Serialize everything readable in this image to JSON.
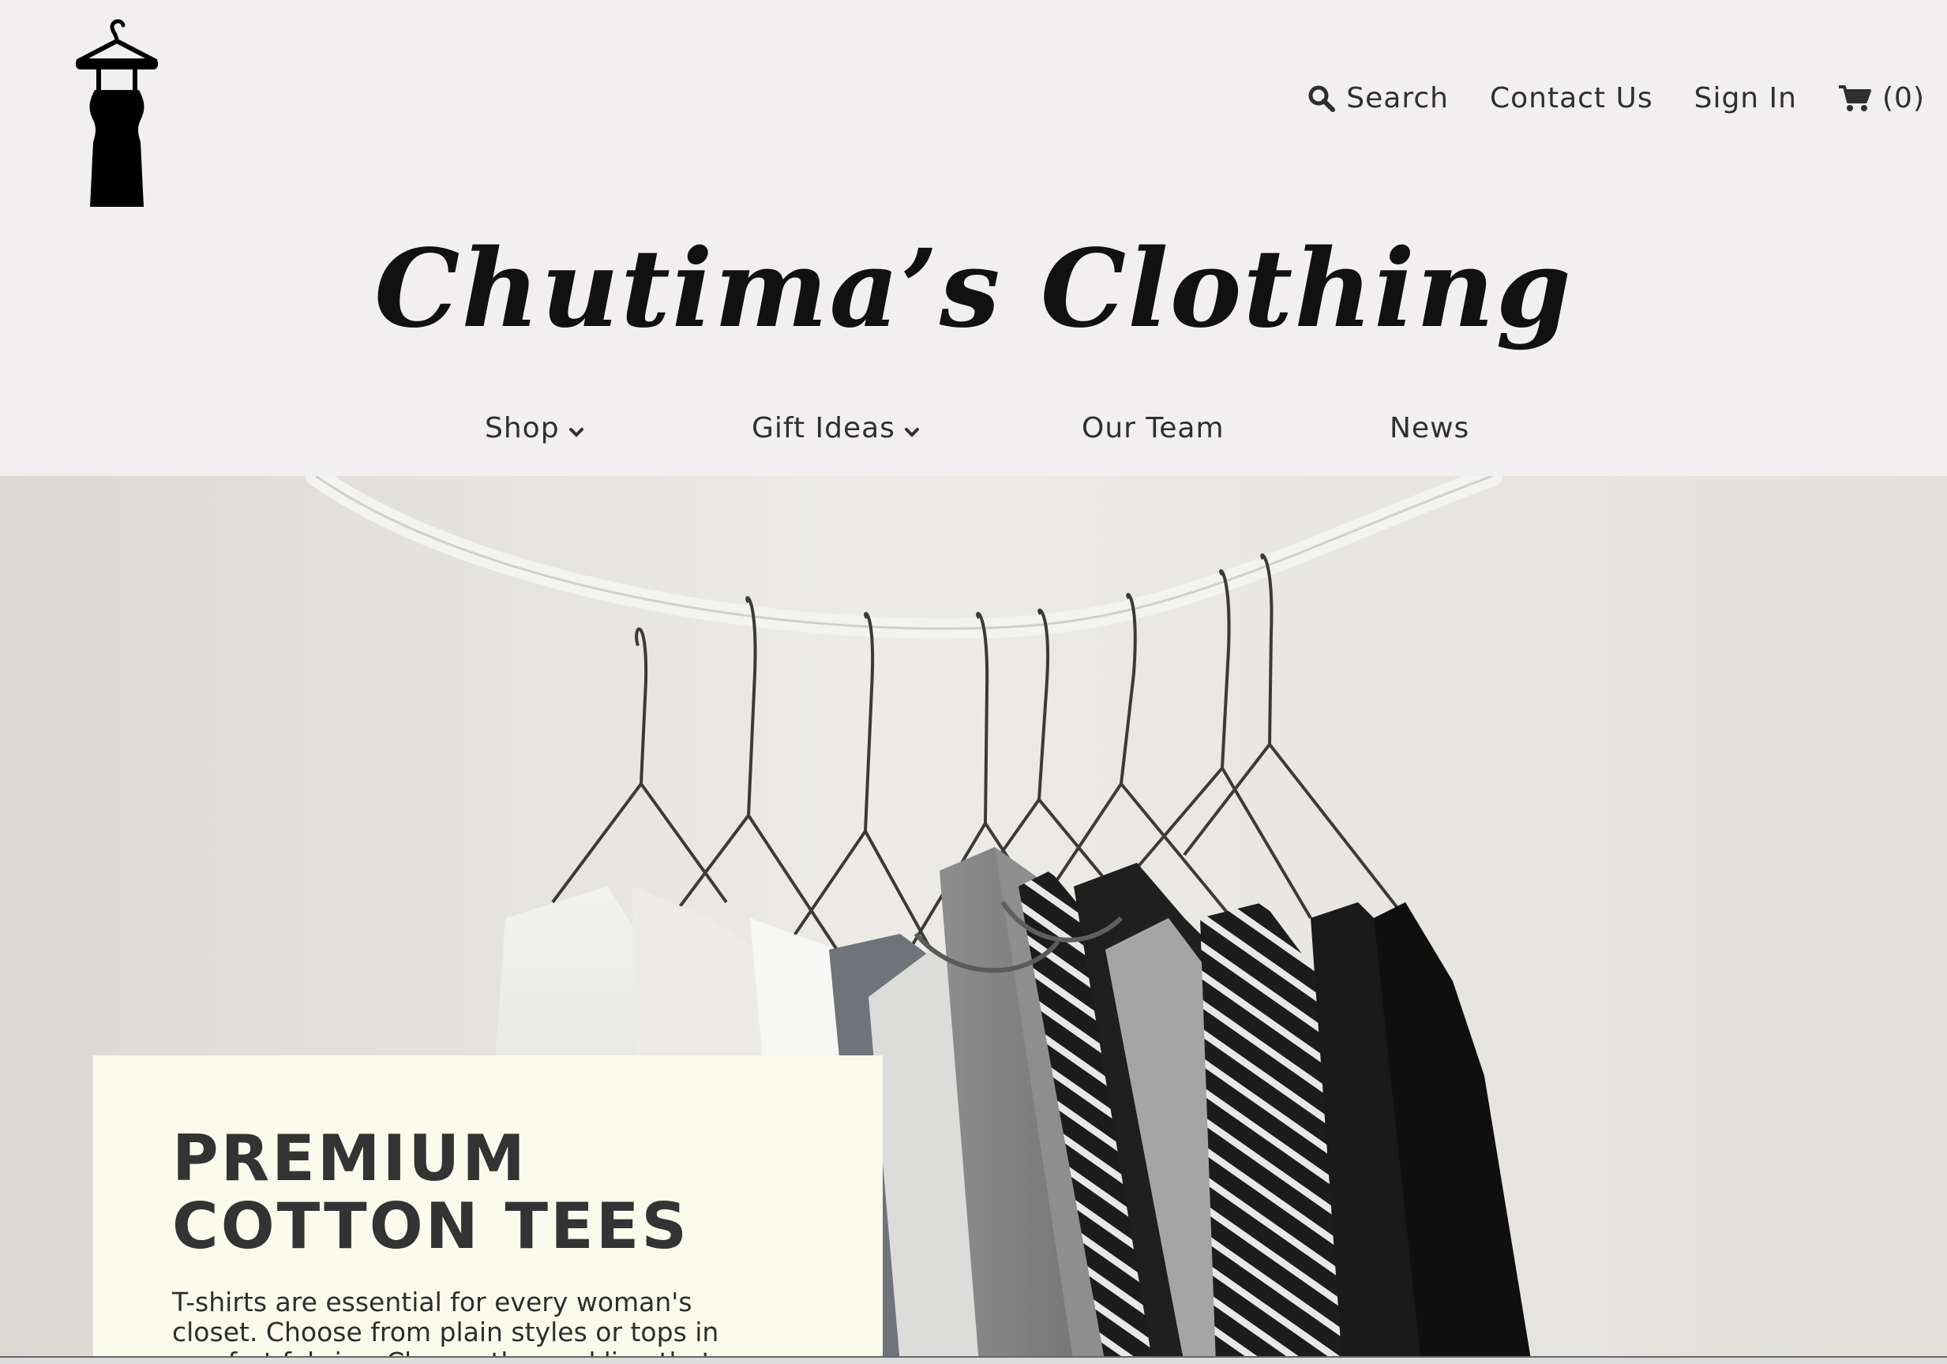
{
  "brand": {
    "name": "Chutima’s Clothing",
    "logo_icon": "dress-on-hanger-icon"
  },
  "utility_nav": {
    "search": {
      "label": "Search",
      "icon": "search-icon"
    },
    "contact": {
      "label": "Contact Us"
    },
    "sign_in": {
      "label": "Sign In"
    },
    "cart": {
      "label": "(0)",
      "icon": "cart-icon"
    }
  },
  "main_nav": [
    {
      "label": "Shop",
      "has_dropdown": true
    },
    {
      "label": "Gift Ideas",
      "has_dropdown": true
    },
    {
      "label": "Our Team",
      "has_dropdown": false
    },
    {
      "label": "News",
      "has_dropdown": false
    }
  ],
  "hero": {
    "image": "clothes-rack-with-tshirts-on-hangers",
    "promo": {
      "title": "PREMIUM COTTON TEES",
      "text": "T-shirts are essential for every woman's closet. Choose from plain styles or tops in comfort fabrics. Choose the neckline that suits you best."
    }
  },
  "colors": {
    "header_bg": "#f1eff0",
    "promo_bg": "#fbfbed",
    "text": "#2f2f2f"
  }
}
